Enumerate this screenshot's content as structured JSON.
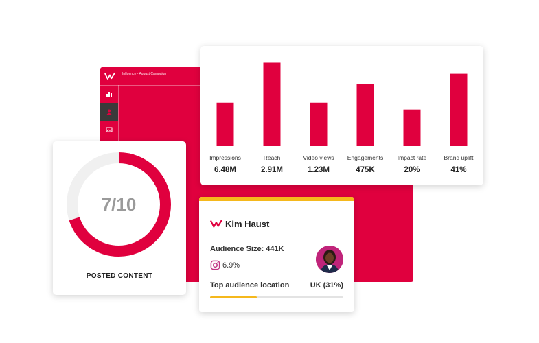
{
  "app_window": {
    "title": "Influence - August Campaign",
    "sidebar": [
      {
        "icon": "bar-chart-icon",
        "active": false
      },
      {
        "icon": "people-icon",
        "active": true
      },
      {
        "icon": "image-icon",
        "active": false
      }
    ]
  },
  "chart_data": {
    "type": "bar",
    "categories": [
      "Impressions",
      "Reach",
      "Video views",
      "Engagements",
      "Impact rate",
      "Brand uplift"
    ],
    "value_labels": [
      "6.48M",
      "2.91M",
      "1.23M",
      "475K",
      "20%",
      "41%"
    ],
    "relative_heights": [
      0.51,
      0.98,
      0.51,
      0.73,
      0.43,
      0.85
    ],
    "color": "#e0003e"
  },
  "posted_content": {
    "value": "7/10",
    "label": "POSTED CONTENT",
    "fraction": 0.7,
    "ring_color": "#e0003e",
    "track_color": "#f0f0f0"
  },
  "profile": {
    "name": "Kim Haust",
    "audience_size": "Audience Size: 441K",
    "instagram_rate": "6.9%",
    "top_location_label": "Top audience location",
    "top_location_value": "UK (31%)",
    "location_fraction": 0.35,
    "accent_color": "#f5b81c"
  }
}
